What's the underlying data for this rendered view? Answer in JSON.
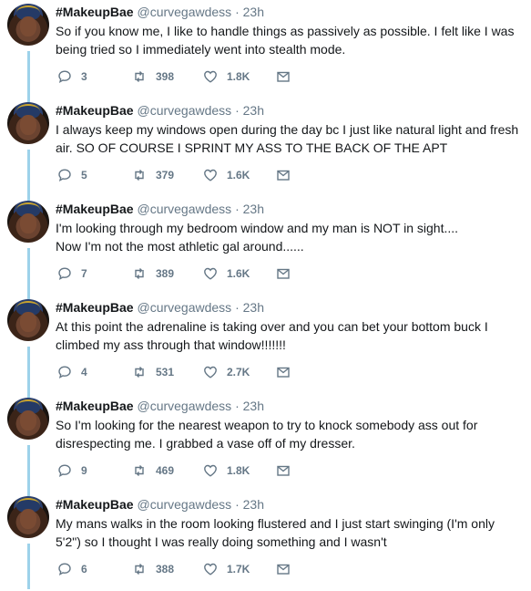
{
  "tweets": [
    {
      "name": "#MakeupBae",
      "handle": "@curvegawdess",
      "sep": "·",
      "time": "23h",
      "text": "So if you know me, I like to handle things as passively as possible. I felt like I was being tried so I immediately went into stealth mode.",
      "replies": "3",
      "retweets": "398",
      "likes": "1.8K"
    },
    {
      "name": "#MakeupBae",
      "handle": "@curvegawdess",
      "sep": "·",
      "time": "23h",
      "text": "I always keep my windows open during the day bc I just like natural light and fresh air. SO OF COURSE I SPRINT MY ASS TO THE BACK OF THE APT",
      "replies": "5",
      "retweets": "379",
      "likes": "1.6K"
    },
    {
      "name": "#MakeupBae",
      "handle": "@curvegawdess",
      "sep": "·",
      "time": "23h",
      "text": "I'm looking through my bedroom window and my man is NOT in sight....\nNow I'm not the most athletic gal around......",
      "replies": "7",
      "retweets": "389",
      "likes": "1.6K"
    },
    {
      "name": "#MakeupBae",
      "handle": "@curvegawdess",
      "sep": "·",
      "time": "23h",
      "text": "At this point the adrenaline is taking over and you can bet your bottom buck I climbed my ass through that window!!!!!!!",
      "replies": "4",
      "retweets": "531",
      "likes": "2.7K"
    },
    {
      "name": "#MakeupBae",
      "handle": "@curvegawdess",
      "sep": "·",
      "time": "23h",
      "text": "So I'm looking for the nearest weapon to try to knock somebody ass out for disrespecting me. I grabbed a vase off of my dresser.",
      "replies": "9",
      "retweets": "469",
      "likes": "1.8K"
    },
    {
      "name": "#MakeupBae",
      "handle": "@curvegawdess",
      "sep": "·",
      "time": "23h",
      "text": "My mans walks in the room looking flustered and I just start swinging (I'm only 5'2\") so I thought I was really doing something and I wasn't",
      "replies": "6",
      "retweets": "388",
      "likes": "1.7K"
    }
  ],
  "icons": {
    "reply": "reply-icon",
    "retweet": "retweet-icon",
    "like": "heart-icon",
    "message": "envelope-icon"
  },
  "colors": {
    "thread_line": "#9dd2ea",
    "text": "#14171a",
    "muted": "#657786"
  }
}
